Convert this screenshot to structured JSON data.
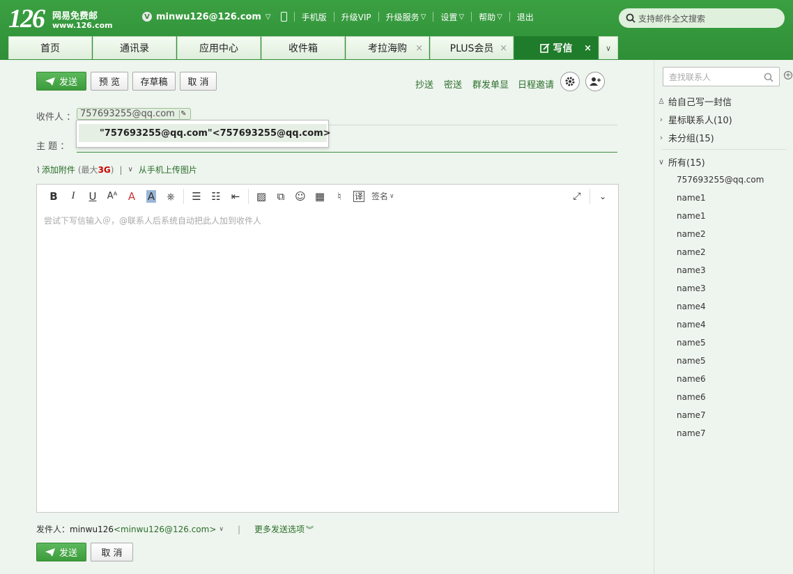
{
  "brand": {
    "logo_number": "126",
    "logo_text1": "网易免费邮",
    "logo_text2": "www.126.com"
  },
  "top_nav": {
    "vip_badge": "V",
    "account": "minwu126@126.com",
    "items": [
      "手机版",
      "升级VIP",
      "升级服务",
      "设置",
      "帮助",
      "退出"
    ]
  },
  "top_search": {
    "placeholder": "支持邮件全文搜索"
  },
  "tabs": [
    {
      "label": "首页"
    },
    {
      "label": "通讯录"
    },
    {
      "label": "应用中心"
    },
    {
      "label": "收件箱"
    },
    {
      "label": "考拉海购",
      "close": "×"
    },
    {
      "label": "PLUS会员",
      "close": "×"
    },
    {
      "label": "写信",
      "close": "×",
      "active": true
    }
  ],
  "toolbar": {
    "send": "发送",
    "preview": "预 览",
    "save_draft": "存草稿",
    "cancel": "取 消",
    "cc": "抄送",
    "bcc": "密送",
    "mass_single": "群发单显",
    "schedule": "日程邀请"
  },
  "compose": {
    "to_label": "收件人 ：",
    "recipient_chip": "757693255@qq.com",
    "suggestion_name": "\"757693255@qq.com\"",
    "suggestion_addr": "<757693255@qq.com>",
    "subject_label": "主    题 ：",
    "attach_label": "添加附件",
    "attach_limit_prefix": "(最大",
    "attach_limit_value": "3G",
    "attach_limit_suffix": ")",
    "upload_from_phone": "从手机上传图片",
    "signature": "签名",
    "body_placeholder": "尝试下写信输入＠，@联系人后系统自动把此人加到收件人"
  },
  "footer": {
    "from_label": "发件人：",
    "from_name": "minwu126",
    "from_addr": "<minwu126@126.com>",
    "more_options": "更多发送选项",
    "send": "发送",
    "cancel": "取 消"
  },
  "sidebar": {
    "search_placeholder": "查找联系人",
    "write_self": "给自己写一封信",
    "starred": "星标联系人(10)",
    "ungrouped": "未分组(15)",
    "all": "所有(15)",
    "contacts": [
      "757693255@qq.com",
      "name1",
      "name1",
      "name2",
      "name2",
      "name3",
      "name3",
      "name4",
      "name4",
      "name5",
      "name5",
      "name6",
      "name6",
      "name7",
      "name7"
    ]
  },
  "colors": {
    "brand_green": "#3ba042",
    "active_tab": "#1f7c2a",
    "link_green": "#2a6e2a"
  }
}
